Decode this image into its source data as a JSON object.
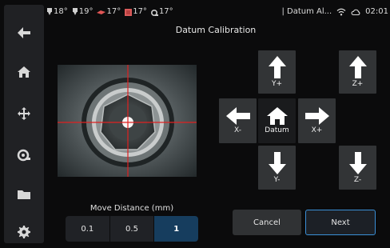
{
  "sidebar": {
    "items": [
      {
        "icon": "back-arrow-icon"
      },
      {
        "icon": "home-icon"
      },
      {
        "icon": "move-icon"
      },
      {
        "icon": "extruder-icon"
      },
      {
        "icon": "folder-icon"
      },
      {
        "icon": "settings-gear-icon"
      }
    ]
  },
  "status": {
    "temps": [
      {
        "icon": "extruder-temp-icon",
        "value": "18°"
      },
      {
        "icon": "extruder-temp-icon",
        "value": "19°"
      },
      {
        "icon": "bed-temp-icon",
        "value": "17°"
      },
      {
        "icon": "chamber-temp-icon",
        "value": "17°"
      },
      {
        "icon": "probe-temp-icon",
        "value": "17°"
      }
    ],
    "printer_name": "| Datum Al...",
    "wifi_icon": "wifi-icon",
    "cloud_icon": "cloud-icon",
    "time": "02:01"
  },
  "page": {
    "title": "Datum Calibration"
  },
  "jog": {
    "y_plus": "Y+",
    "y_minus": "Y-",
    "x_minus": "X-",
    "x_plus": "X+",
    "datum": "Datum",
    "z_plus": "Z+",
    "z_minus": "Z-"
  },
  "move_distance": {
    "label": "Move Distance (mm)",
    "options": [
      "0.1",
      "0.5",
      "1"
    ],
    "selected": "1"
  },
  "actions": {
    "cancel": "Cancel",
    "next": "Next"
  },
  "colors": {
    "accent": "#3a8fd6",
    "selected_segment": "#163d5e",
    "crosshair": "#e02020"
  }
}
